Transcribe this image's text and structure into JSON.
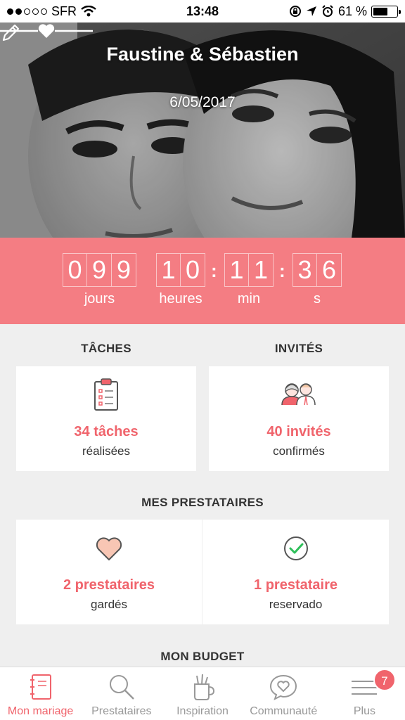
{
  "status_bar": {
    "carrier": "SFR",
    "time": "13:48",
    "battery": "61 %",
    "battery_level": 0.61
  },
  "hero": {
    "couple_names": "Faustine & Sébastien",
    "wedding_date": "6/05/2017"
  },
  "countdown": {
    "days": [
      "0",
      "9",
      "9"
    ],
    "hours": [
      "1",
      "0"
    ],
    "minutes": [
      "1",
      "1"
    ],
    "seconds": [
      "3",
      "6"
    ],
    "labels": {
      "days": "jours",
      "hours": "heures",
      "minutes": "min",
      "seconds": "s"
    },
    "accent_color": "#f47d83"
  },
  "tasks": {
    "title": "TÂCHES",
    "value": "34 tâches",
    "sub": "réalisées"
  },
  "guests": {
    "title": "INVITÉS",
    "value": "40 invités",
    "sub": "confirmés"
  },
  "vendors": {
    "title": "MES PRESTATAIRES",
    "kept": {
      "value": "2 prestataires",
      "sub": "gardés"
    },
    "booked": {
      "value": "1 prestataire",
      "sub": "reservado"
    }
  },
  "budget": {
    "title": "MON BUDGET"
  },
  "tabbar": {
    "items": [
      {
        "label": "Mon mariage",
        "icon": "notebook-icon",
        "active": true
      },
      {
        "label": "Prestataires",
        "icon": "search-icon"
      },
      {
        "label": "Inspiration",
        "icon": "cup-icon"
      },
      {
        "label": "Communauté",
        "icon": "chat-heart-icon"
      },
      {
        "label": "Plus",
        "icon": "menu-icon",
        "badge": "7"
      }
    ]
  },
  "colors": {
    "accent": "#f0646c",
    "countdown_bg": "#f47d83",
    "background": "#efefef"
  }
}
